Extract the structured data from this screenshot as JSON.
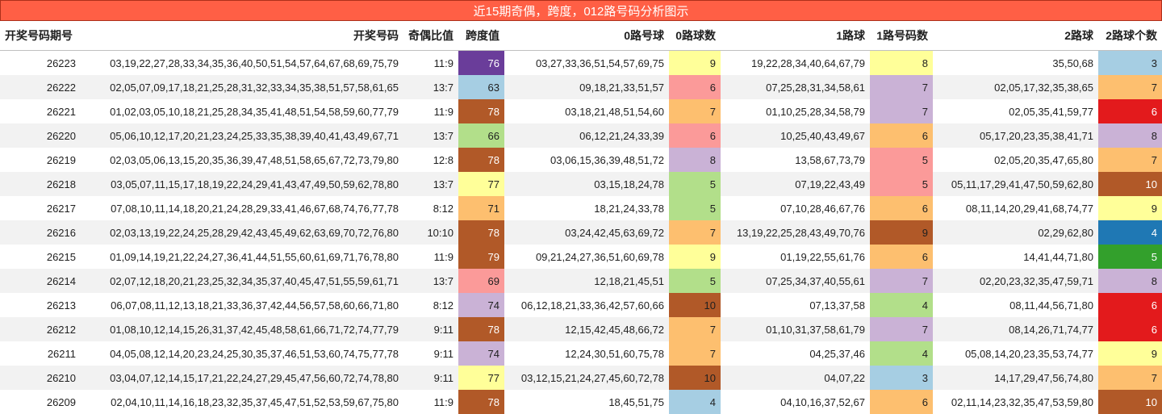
{
  "title": "近15期奇偶，跨度，012路号码分析图示",
  "columns": [
    "开奖号码期号",
    "开奖号码",
    "奇偶比值",
    "跨度值",
    "0路号球",
    "0路球数",
    "1路球",
    "1路号码数",
    "2路球",
    "2路球个数"
  ],
  "rows": [
    {
      "issue": "26223",
      "numbers": "03,19,22,27,28,33,34,35,36,40,50,51,54,57,64,67,68,69,75,79",
      "ratio": "11:9",
      "span": "76",
      "span_color": "#6a3d9a",
      "span_text": "#ffffff",
      "r0": "03,27,33,36,51,54,57,69,75",
      "c0": "9",
      "c0_color": "#ffff99",
      "r1": "19,22,28,34,40,64,67,79",
      "c1": "8",
      "c1_color": "#ffff99",
      "r2": "35,50,68",
      "c2": "3",
      "c2_color": "#a6cee3",
      "c2_text": "#1f1f1f"
    },
    {
      "issue": "26222",
      "numbers": "02,05,07,09,17,18,21,25,28,31,32,33,34,35,38,51,57,58,61,65",
      "ratio": "13:7",
      "span": "63",
      "span_color": "#a6cee3",
      "span_text": "#1f1f1f",
      "r0": "09,18,21,33,51,57",
      "c0": "6",
      "c0_color": "#fb9a99",
      "r1": "07,25,28,31,34,58,61",
      "c1": "7",
      "c1_color": "#cab2d6",
      "r2": "02,05,17,32,35,38,65",
      "c2": "7",
      "c2_color": "#fdbf6f",
      "c2_text": "#1f1f1f"
    },
    {
      "issue": "26221",
      "numbers": "01,02,03,05,10,18,21,25,28,34,35,41,48,51,54,58,59,60,77,79",
      "ratio": "11:9",
      "span": "78",
      "span_color": "#b15928",
      "span_text": "#ffffff",
      "r0": "03,18,21,48,51,54,60",
      "c0": "7",
      "c0_color": "#fdbf6f",
      "r1": "01,10,25,28,34,58,79",
      "c1": "7",
      "c1_color": "#cab2d6",
      "r2": "02,05,35,41,59,77",
      "c2": "6",
      "c2_color": "#e31a1c",
      "c2_text": "#ffffff"
    },
    {
      "issue": "26220",
      "numbers": "05,06,10,12,17,20,21,23,24,25,33,35,38,39,40,41,43,49,67,71",
      "ratio": "13:7",
      "span": "66",
      "span_color": "#b2df8a",
      "span_text": "#1f1f1f",
      "r0": "06,12,21,24,33,39",
      "c0": "6",
      "c0_color": "#fb9a99",
      "r1": "10,25,40,43,49,67",
      "c1": "6",
      "c1_color": "#fdbf6f",
      "r2": "05,17,20,23,35,38,41,71",
      "c2": "8",
      "c2_color": "#cab2d6",
      "c2_text": "#1f1f1f"
    },
    {
      "issue": "26219",
      "numbers": "02,03,05,06,13,15,20,35,36,39,47,48,51,58,65,67,72,73,79,80",
      "ratio": "12:8",
      "span": "78",
      "span_color": "#b15928",
      "span_text": "#ffffff",
      "r0": "03,06,15,36,39,48,51,72",
      "c0": "8",
      "c0_color": "#cab2d6",
      "r1": "13,58,67,73,79",
      "c1": "5",
      "c1_color": "#fb9a99",
      "r2": "02,05,20,35,47,65,80",
      "c2": "7",
      "c2_color": "#fdbf6f",
      "c2_text": "#1f1f1f"
    },
    {
      "issue": "26218",
      "numbers": "03,05,07,11,15,17,18,19,22,24,29,41,43,47,49,50,59,62,78,80",
      "ratio": "13:7",
      "span": "77",
      "span_color": "#ffff99",
      "span_text": "#1f1f1f",
      "r0": "03,15,18,24,78",
      "c0": "5",
      "c0_color": "#b2df8a",
      "r1": "07,19,22,43,49",
      "c1": "5",
      "c1_color": "#fb9a99",
      "r2": "05,11,17,29,41,47,50,59,62,80",
      "c2": "10",
      "c2_color": "#b15928",
      "c2_text": "#ffffff"
    },
    {
      "issue": "26217",
      "numbers": "07,08,10,11,14,18,20,21,24,28,29,33,41,46,67,68,74,76,77,78",
      "ratio": "8:12",
      "span": "71",
      "span_color": "#fdbf6f",
      "span_text": "#1f1f1f",
      "r0": "18,21,24,33,78",
      "c0": "5",
      "c0_color": "#b2df8a",
      "r1": "07,10,28,46,67,76",
      "c1": "6",
      "c1_color": "#fdbf6f",
      "r2": "08,11,14,20,29,41,68,74,77",
      "c2": "9",
      "c2_color": "#ffff99",
      "c2_text": "#1f1f1f"
    },
    {
      "issue": "26216",
      "numbers": "02,03,13,19,22,24,25,28,29,42,43,45,49,62,63,69,70,72,76,80",
      "ratio": "10:10",
      "span": "78",
      "span_color": "#b15928",
      "span_text": "#ffffff",
      "r0": "03,24,42,45,63,69,72",
      "c0": "7",
      "c0_color": "#fdbf6f",
      "r1": "13,19,22,25,28,43,49,70,76",
      "c1": "9",
      "c1_color": "#b15928",
      "r2": "02,29,62,80",
      "c2": "4",
      "c2_color": "#1f78b4",
      "c2_text": "#ffffff"
    },
    {
      "issue": "26215",
      "numbers": "01,09,14,19,21,22,24,27,36,41,44,51,55,60,61,69,71,76,78,80",
      "ratio": "11:9",
      "span": "79",
      "span_color": "#b15928",
      "span_text": "#ffffff",
      "r0": "09,21,24,27,36,51,60,69,78",
      "c0": "9",
      "c0_color": "#ffff99",
      "r1": "01,19,22,55,61,76",
      "c1": "6",
      "c1_color": "#fdbf6f",
      "r2": "14,41,44,71,80",
      "c2": "5",
      "c2_color": "#33a02c",
      "c2_text": "#ffffff"
    },
    {
      "issue": "26214",
      "numbers": "02,07,12,18,20,21,23,25,32,34,35,37,40,45,47,51,55,59,61,71",
      "ratio": "13:7",
      "span": "69",
      "span_color": "#fb9a99",
      "span_text": "#1f1f1f",
      "r0": "12,18,21,45,51",
      "c0": "5",
      "c0_color": "#b2df8a",
      "r1": "07,25,34,37,40,55,61",
      "c1": "7",
      "c1_color": "#cab2d6",
      "r2": "02,20,23,32,35,47,59,71",
      "c2": "8",
      "c2_color": "#cab2d6",
      "c2_text": "#1f1f1f"
    },
    {
      "issue": "26213",
      "numbers": "06,07,08,11,12,13,18,21,33,36,37,42,44,56,57,58,60,66,71,80",
      "ratio": "8:12",
      "span": "74",
      "span_color": "#cab2d6",
      "span_text": "#1f1f1f",
      "r0": "06,12,18,21,33,36,42,57,60,66",
      "c0": "10",
      "c0_color": "#b15928",
      "r1": "07,13,37,58",
      "c1": "4",
      "c1_color": "#b2df8a",
      "r2": "08,11,44,56,71,80",
      "c2": "6",
      "c2_color": "#e31a1c",
      "c2_text": "#ffffff"
    },
    {
      "issue": "26212",
      "numbers": "01,08,10,12,14,15,26,31,37,42,45,48,58,61,66,71,72,74,77,79",
      "ratio": "9:11",
      "span": "78",
      "span_color": "#b15928",
      "span_text": "#ffffff",
      "r0": "12,15,42,45,48,66,72",
      "c0": "7",
      "c0_color": "#fdbf6f",
      "r1": "01,10,31,37,58,61,79",
      "c1": "7",
      "c1_color": "#cab2d6",
      "r2": "08,14,26,71,74,77",
      "c2": "6",
      "c2_color": "#e31a1c",
      "c2_text": "#ffffff"
    },
    {
      "issue": "26211",
      "numbers": "04,05,08,12,14,20,23,24,25,30,35,37,46,51,53,60,74,75,77,78",
      "ratio": "9:11",
      "span": "74",
      "span_color": "#cab2d6",
      "span_text": "#1f1f1f",
      "r0": "12,24,30,51,60,75,78",
      "c0": "7",
      "c0_color": "#fdbf6f",
      "r1": "04,25,37,46",
      "c1": "4",
      "c1_color": "#b2df8a",
      "r2": "05,08,14,20,23,35,53,74,77",
      "c2": "9",
      "c2_color": "#ffff99",
      "c2_text": "#1f1f1f"
    },
    {
      "issue": "26210",
      "numbers": "03,04,07,12,14,15,17,21,22,24,27,29,45,47,56,60,72,74,78,80",
      "ratio": "9:11",
      "span": "77",
      "span_color": "#ffff99",
      "span_text": "#1f1f1f",
      "r0": "03,12,15,21,24,27,45,60,72,78",
      "c0": "10",
      "c0_color": "#b15928",
      "r1": "04,07,22",
      "c1": "3",
      "c1_color": "#a6cee3",
      "r2": "14,17,29,47,56,74,80",
      "c2": "7",
      "c2_color": "#fdbf6f",
      "c2_text": "#1f1f1f"
    },
    {
      "issue": "26209",
      "numbers": "02,04,10,11,14,16,18,23,32,35,37,45,47,51,52,53,59,67,75,80",
      "ratio": "11:9",
      "span": "78",
      "span_color": "#b15928",
      "span_text": "#ffffff",
      "r0": "18,45,51,75",
      "c0": "4",
      "c0_color": "#a6cee3",
      "r1": "04,10,16,37,52,67",
      "c1": "6",
      "c1_color": "#fdbf6f",
      "r2": "02,11,14,23,32,35,47,53,59,80",
      "c2": "10",
      "c2_color": "#b15928",
      "c2_text": "#ffffff"
    }
  ]
}
